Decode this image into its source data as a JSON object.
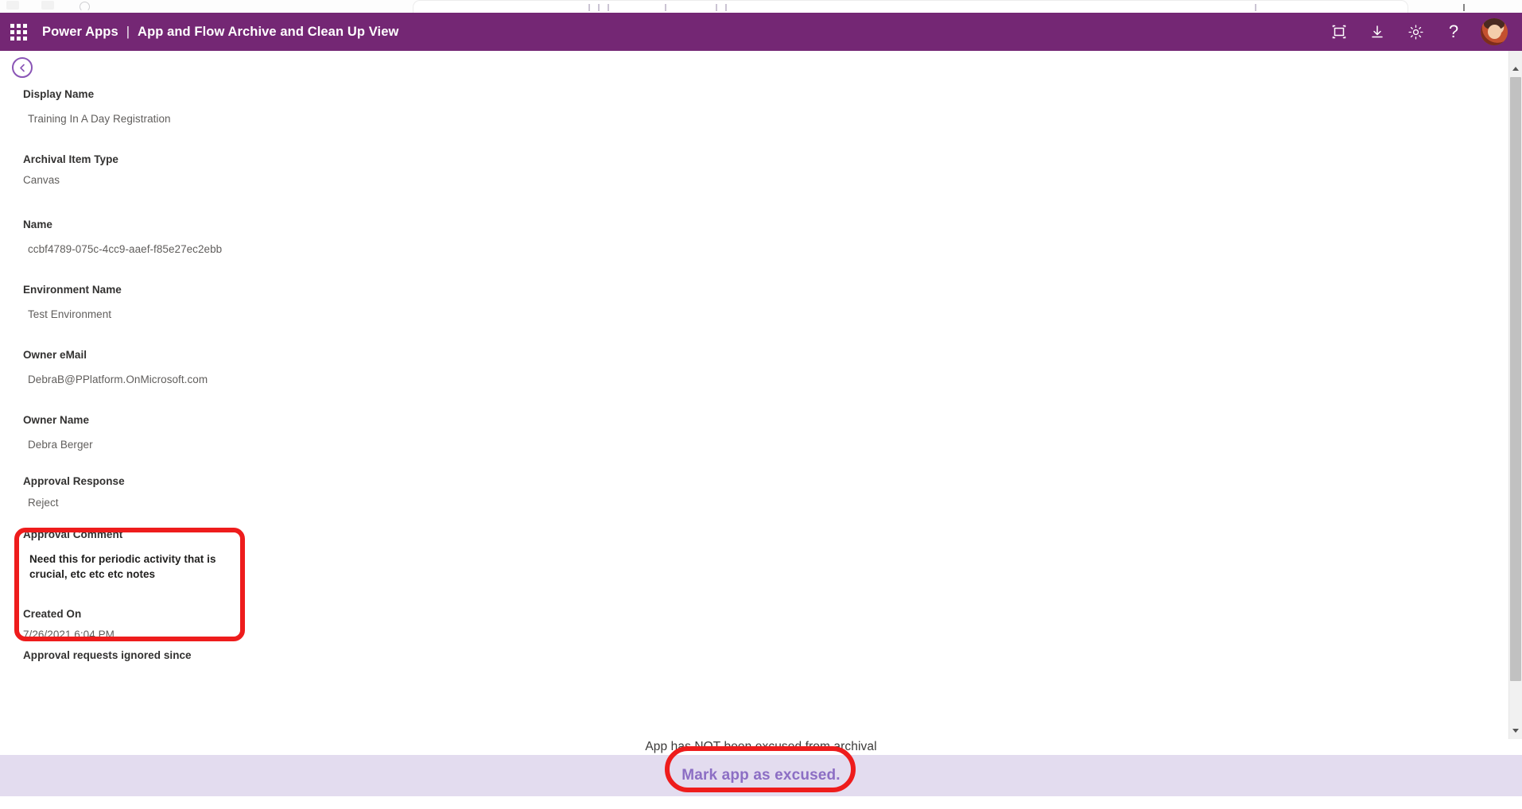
{
  "theme": {
    "header_purple": "#742774",
    "action_bar_lavender": "#e3dcef",
    "button_purple": "#8c6ec4",
    "back_button_purple": "#8a55b6",
    "annotation_red": "#ee1c1c"
  },
  "header": {
    "waffle_icon": "app-launcher-waffle-icon",
    "brand": "Power Apps",
    "separator": "|",
    "title": "App and Flow Archive and Clean Up View",
    "actions": [
      {
        "name": "fullscreen-icon",
        "tooltip": "Fullscreen"
      },
      {
        "name": "download-icon",
        "tooltip": "Download"
      },
      {
        "name": "gear-icon",
        "tooltip": "Settings"
      },
      {
        "name": "help-icon",
        "label": "?",
        "tooltip": "Help"
      }
    ],
    "avatar_alt": "User account photo"
  },
  "toolbar": {
    "back_icon": "chevron-left-icon",
    "back_tooltip": "Back"
  },
  "form": {
    "fields": [
      {
        "label": "Display Name",
        "value": "Training In A Day Registration"
      },
      {
        "label": "Archival Item Type",
        "value": "Canvas"
      },
      {
        "label": "Name",
        "value": "ccbf4789-075c-4cc9-aaef-f85e27ec2ebb"
      },
      {
        "label": "Environment Name",
        "value": "Test Environment"
      },
      {
        "label": "Owner eMail",
        "value": "DebraB@PPlatform.OnMicrosoft.com"
      },
      {
        "label": "Owner Name",
        "value": "Debra Berger"
      },
      {
        "label": "Approval Response",
        "value": "Reject"
      },
      {
        "label": "Approval Comment",
        "value": "Need this for periodic activity that is crucial, etc etc etc notes"
      },
      {
        "label": "Created On",
        "value": "7/26/2021 6:04 PM"
      },
      {
        "label": "Approval requests ignored since",
        "value": ""
      }
    ]
  },
  "footer": {
    "status_text": "App has NOT been excused from archival",
    "excuse_button_label": "Mark app as excused."
  },
  "scrollbar": {
    "up_arrow": "scroll-up-arrow-icon",
    "down_arrow": "scroll-down-arrow-icon"
  },
  "annotations": [
    {
      "name": "approval-comment-highlight",
      "shape": "rounded-rectangle"
    },
    {
      "name": "excuse-button-highlight",
      "shape": "rounded-oval"
    }
  ]
}
